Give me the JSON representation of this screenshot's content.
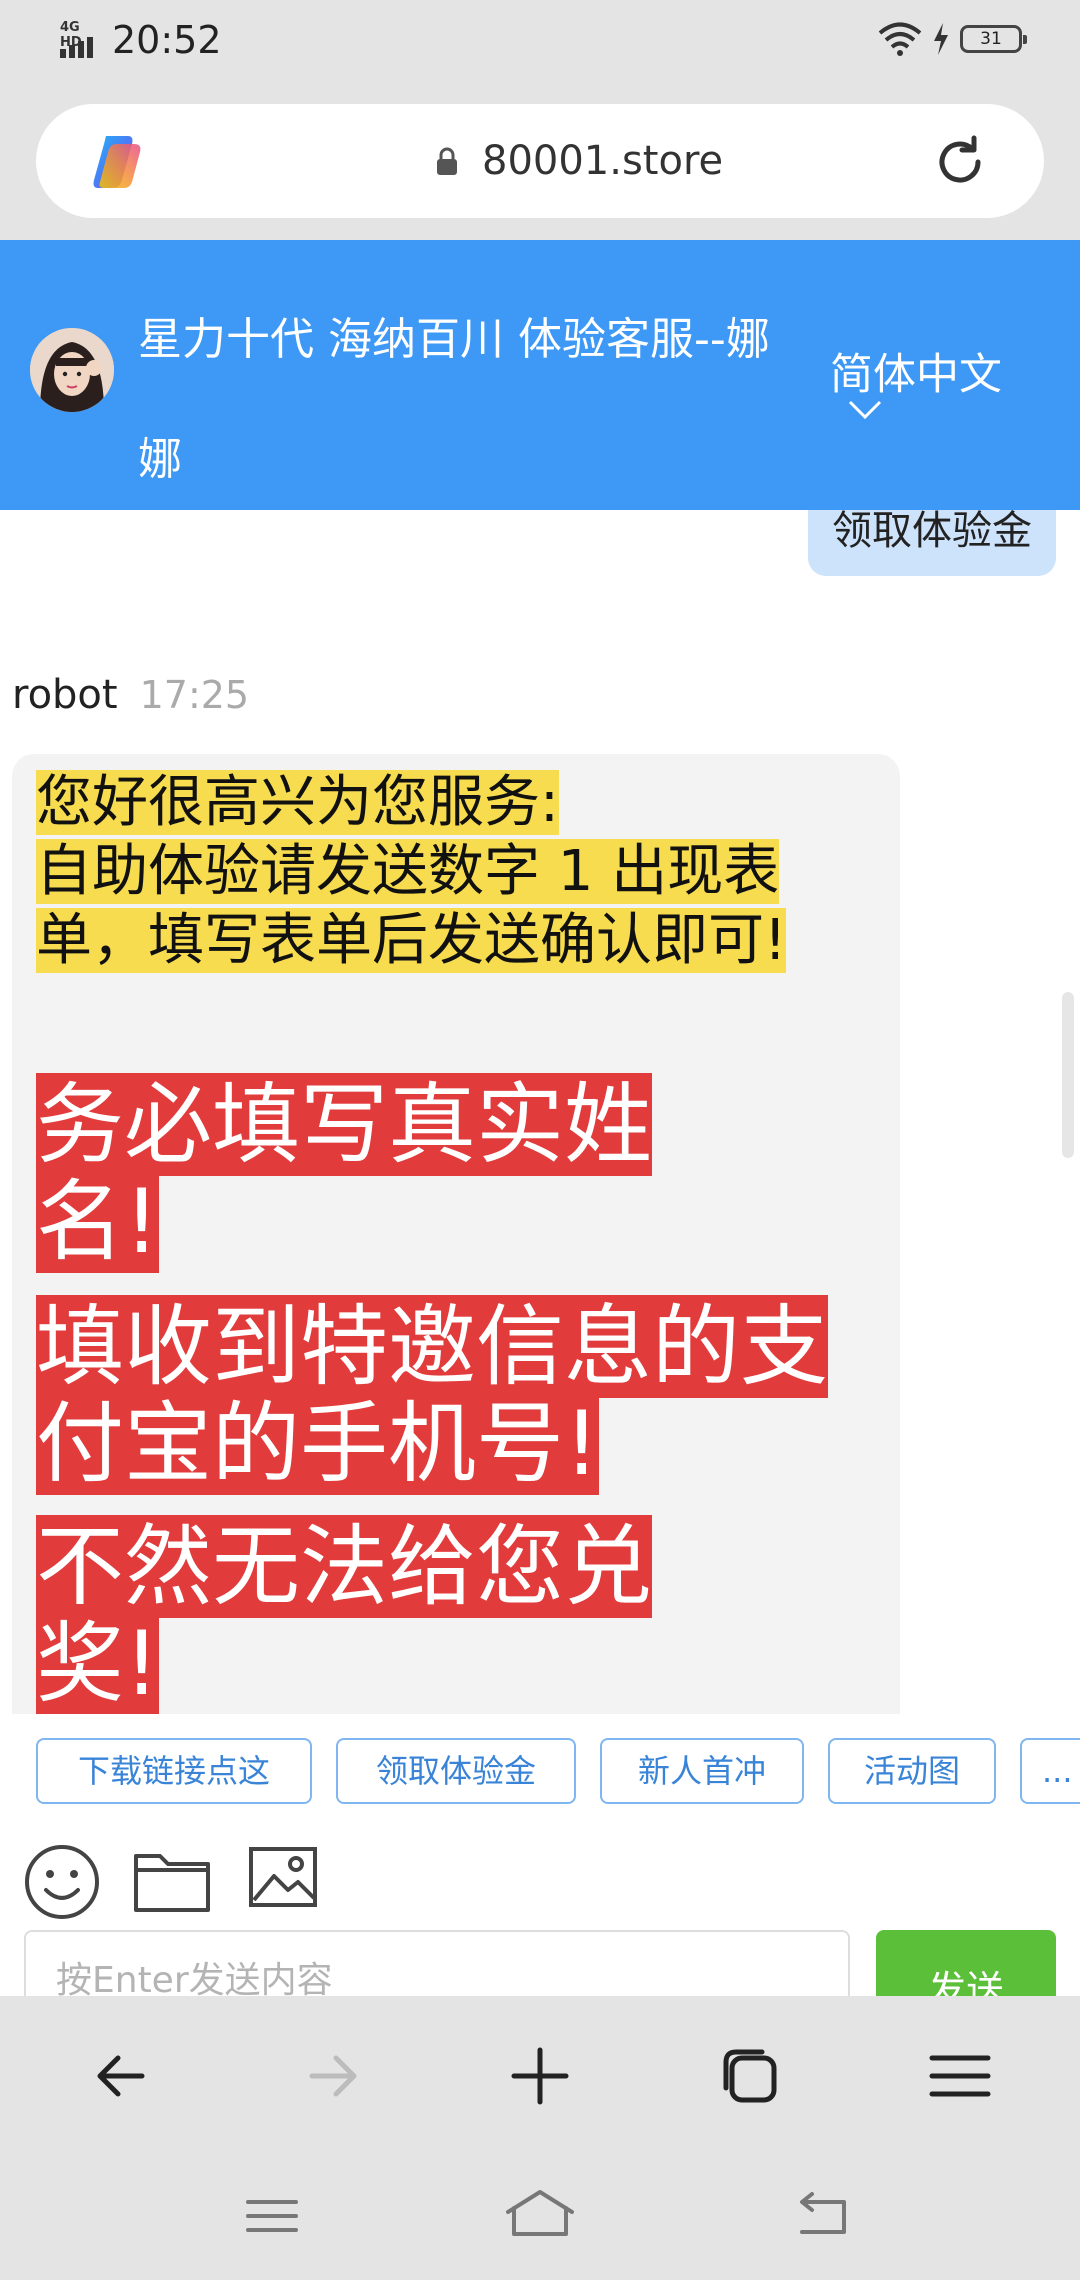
{
  "status_bar": {
    "network": "4G HD",
    "time": "20:52",
    "battery": "31"
  },
  "url_bar": {
    "url": "80001.store"
  },
  "chat_header": {
    "title": "星力十代 海纳百川 体验客服--娜娜",
    "language": "简体中文"
  },
  "messages": {
    "my_message": "领取体验金",
    "sender_name": "robot",
    "sender_time": "17:25",
    "bot_lines_yellow": "您好很高兴为您服务:\n自助体验请发送数字 1 出现表单，填写表单后发送确认即可!",
    "bot_line_red_1": "务必填写真实姓名!",
    "bot_line_red_2": "填收到特邀信息的支付宝的手机号!",
    "bot_line_red_3": "不然无法给您兑奖!"
  },
  "quick_replies": [
    "下载链接点这",
    "领取体验金",
    "新人首冲",
    "活动图",
    "..."
  ],
  "composer": {
    "placeholder": "按Enter发送内容",
    "send_label": "发送"
  },
  "colors": {
    "header_blue": "#3d99f5",
    "send_green": "#5cbf3a",
    "highlight_yellow": "#f6dc4e",
    "highlight_red": "#e23b3b"
  },
  "icons": {
    "toolbar": [
      "back-arrow-icon",
      "forward-arrow-icon",
      "plus-icon",
      "tabs-icon",
      "menu-icon"
    ],
    "system_nav": [
      "recent-apps-icon",
      "home-icon",
      "back-icon"
    ]
  }
}
